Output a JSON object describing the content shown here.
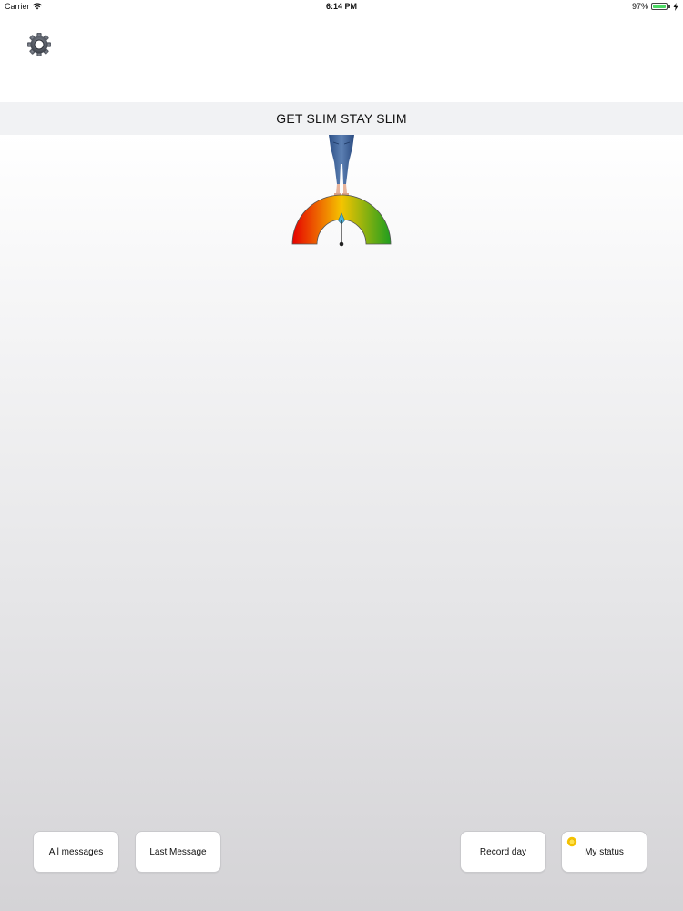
{
  "status_bar": {
    "carrier": "Carrier",
    "time": "6:14 PM",
    "battery_text": "97%",
    "battery_level": 0.97
  },
  "header": {
    "title": "GET SLIM STAY SLIM"
  },
  "gauge": {
    "icon": "meter-gauge",
    "colors": [
      "#e60000",
      "#f5c400",
      "#1f9e1f"
    ]
  },
  "actions": {
    "all_messages": "All messages",
    "last_message": "Last Message",
    "record_day": "Record day",
    "my_status": "My status"
  },
  "icons": {
    "settings": "gear-icon",
    "status_indicator": "sun-icon"
  }
}
